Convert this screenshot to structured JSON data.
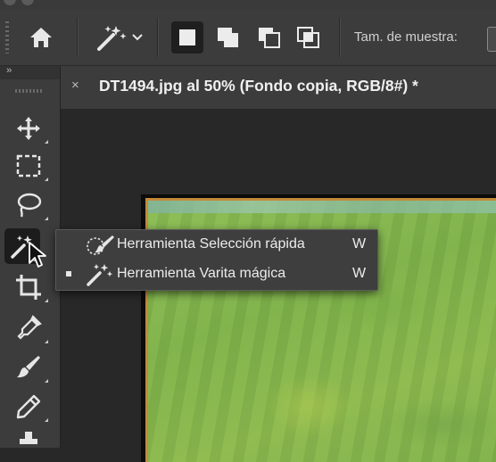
{
  "options_bar": {
    "sample_size_label": "Tam. de muestra:"
  },
  "tools": [
    {
      "name": "move-tool",
      "icon": "move-icon"
    },
    {
      "name": "marquee-tool",
      "icon": "marquee-icon"
    },
    {
      "name": "lasso-tool",
      "icon": "lasso-icon"
    },
    {
      "name": "magic-wand-tool",
      "icon": "magic-wand-icon",
      "active": true
    },
    {
      "name": "crop-tool",
      "icon": "crop-icon"
    },
    {
      "name": "eyedropper-tool",
      "icon": "eyedropper-icon"
    },
    {
      "name": "brush-tool",
      "icon": "brush-icon"
    },
    {
      "name": "pencil-tool",
      "icon": "pencil-icon"
    }
  ],
  "document_tab": {
    "close": "×",
    "title": "DT1494.jpg al 50% (Fondo copia, RGB/8#) *"
  },
  "flyout": {
    "items": [
      {
        "label": "Herramienta Selección rápida",
        "shortcut": "W",
        "selected": false
      },
      {
        "label": "Herramienta Varita mágica",
        "shortcut": "W",
        "selected": true
      }
    ]
  },
  "colors": {
    "panel": "#3c3c3c",
    "canvas_bg": "#282828",
    "painting_green": "#8fbf5b",
    "painting_frame": "#c38a3a"
  }
}
